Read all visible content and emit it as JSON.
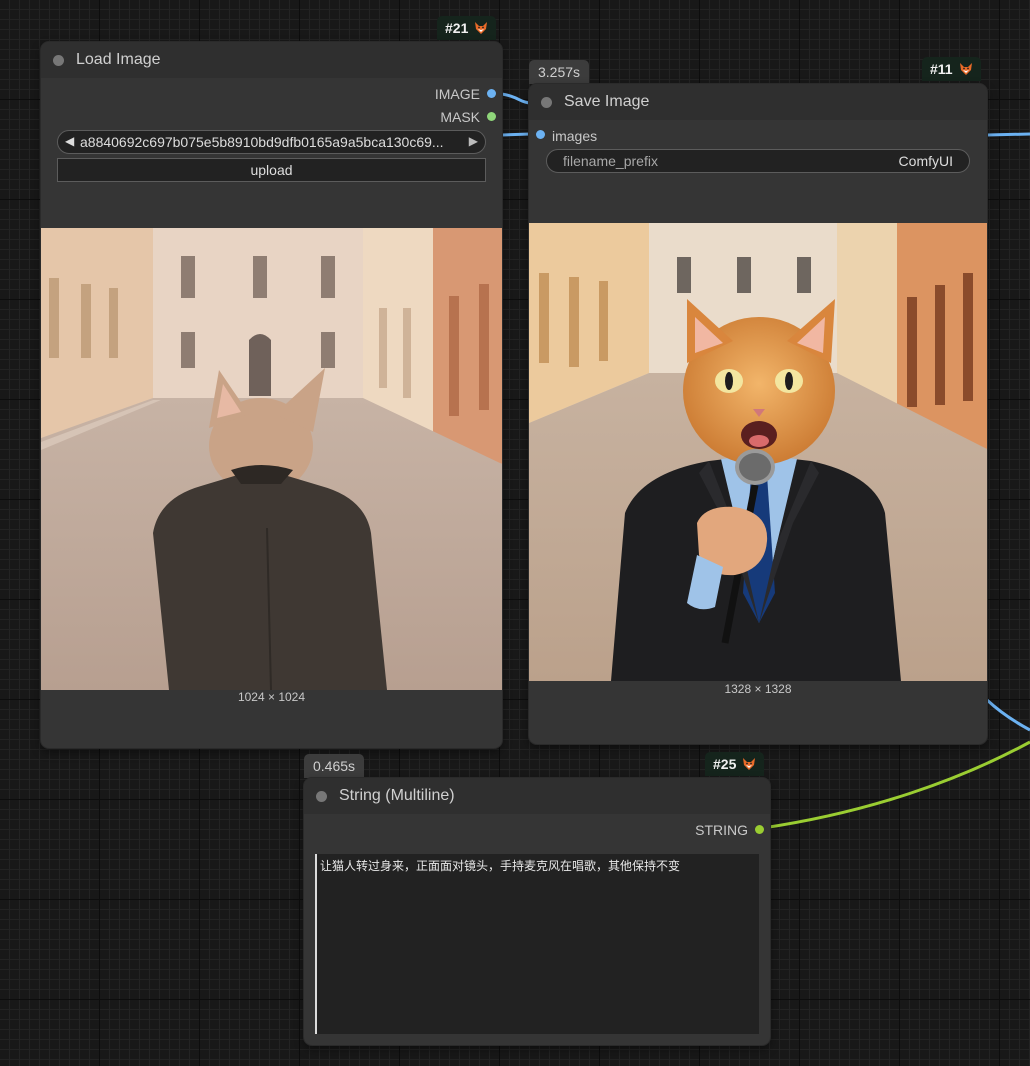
{
  "nodes": {
    "load_image": {
      "id": "#21",
      "title": "Load Image",
      "outputs": {
        "image": "IMAGE",
        "mask": "MASK"
      },
      "image_combo_value": "a8840692c697b075e5b8910bd9dfb0165a9a5bca130c69...",
      "upload_label": "upload",
      "image_size": "1024 × 1024"
    },
    "save_image": {
      "id": "#11",
      "timing": "3.257s",
      "title": "Save Image",
      "inputs": {
        "images": "images"
      },
      "filename_prefix_label": "filename_prefix",
      "filename_prefix_value": "ComfyUI",
      "image_size": "1328 × 1328"
    },
    "string_multiline": {
      "id": "#25",
      "timing": "0.465s",
      "title": "String (Multiline)",
      "outputs": {
        "string": "STRING"
      },
      "text": "让猫人转过身来，正面面对镜头，手持麦克风在唱歌，其他保持不变"
    }
  },
  "colors": {
    "canvas_bg": "#181818",
    "node_bg": "#353535",
    "image_link": "#6cb2f2",
    "string_link": "#9acd32",
    "id_badge_bg": "#15241c"
  },
  "icons": [
    "fox-icon"
  ]
}
